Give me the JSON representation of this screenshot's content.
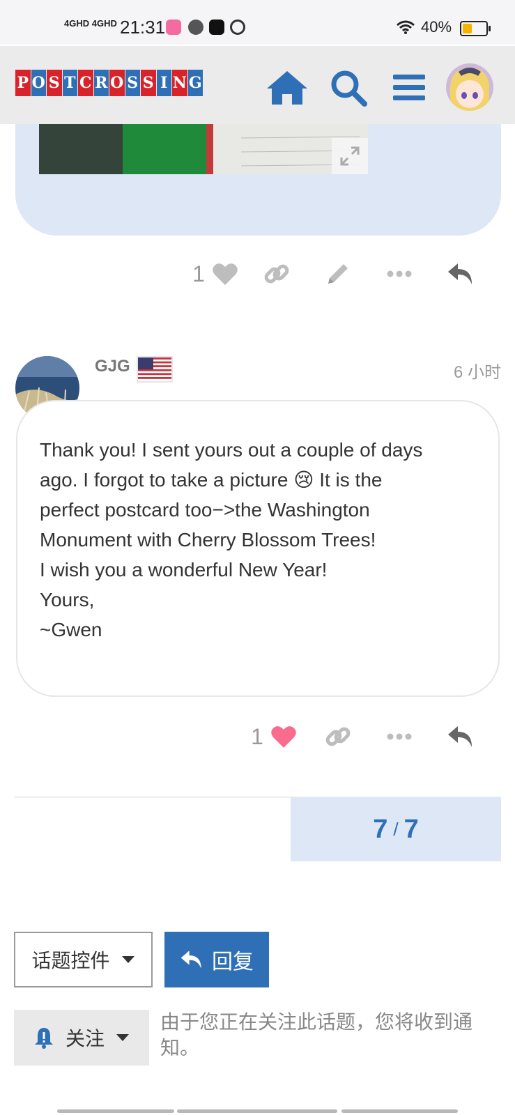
{
  "status_bar": {
    "network": "4GHD 4GHD",
    "time": "21:31",
    "battery_text": "40%"
  },
  "header": {
    "logo_letters": [
      "P",
      "O",
      "S",
      "T",
      "C",
      "R",
      "O",
      "S",
      "S",
      "I",
      "N",
      "G"
    ],
    "icons": [
      "home-icon",
      "search-icon",
      "hamburger-menu-icon"
    ]
  },
  "post1": {
    "like_count": "1",
    "actions": [
      "like",
      "link",
      "edit",
      "more",
      "reply"
    ]
  },
  "post2": {
    "username": "GJG",
    "time": "6 小时",
    "flag": "us-flag",
    "lines": [
      "Thank you! I sent yours out a couple of days",
      "ago. I forgot to take a picture",
      "It is the",
      "perfect postcard too−>the Washington",
      "Monument with Cherry Blossom Trees!",
      "I wish you a wonderful New Year!",
      "Yours,",
      "~Gwen"
    ],
    "emoji": "😢",
    "like_count": "1",
    "liked_color": "#fa6c8d"
  },
  "progress": {
    "current": "7",
    "separator": "/",
    "total": "7"
  },
  "controls": {
    "topic_controls_label": "话题控件",
    "reply_label": "回复",
    "notification_label": "关注",
    "notification_text": "由于您正在关注此话题，您将收到通知。"
  },
  "colors": {
    "accent": "#2f6fb6",
    "post_bg": "#dde7f5",
    "logo_red": "#d8232a"
  }
}
